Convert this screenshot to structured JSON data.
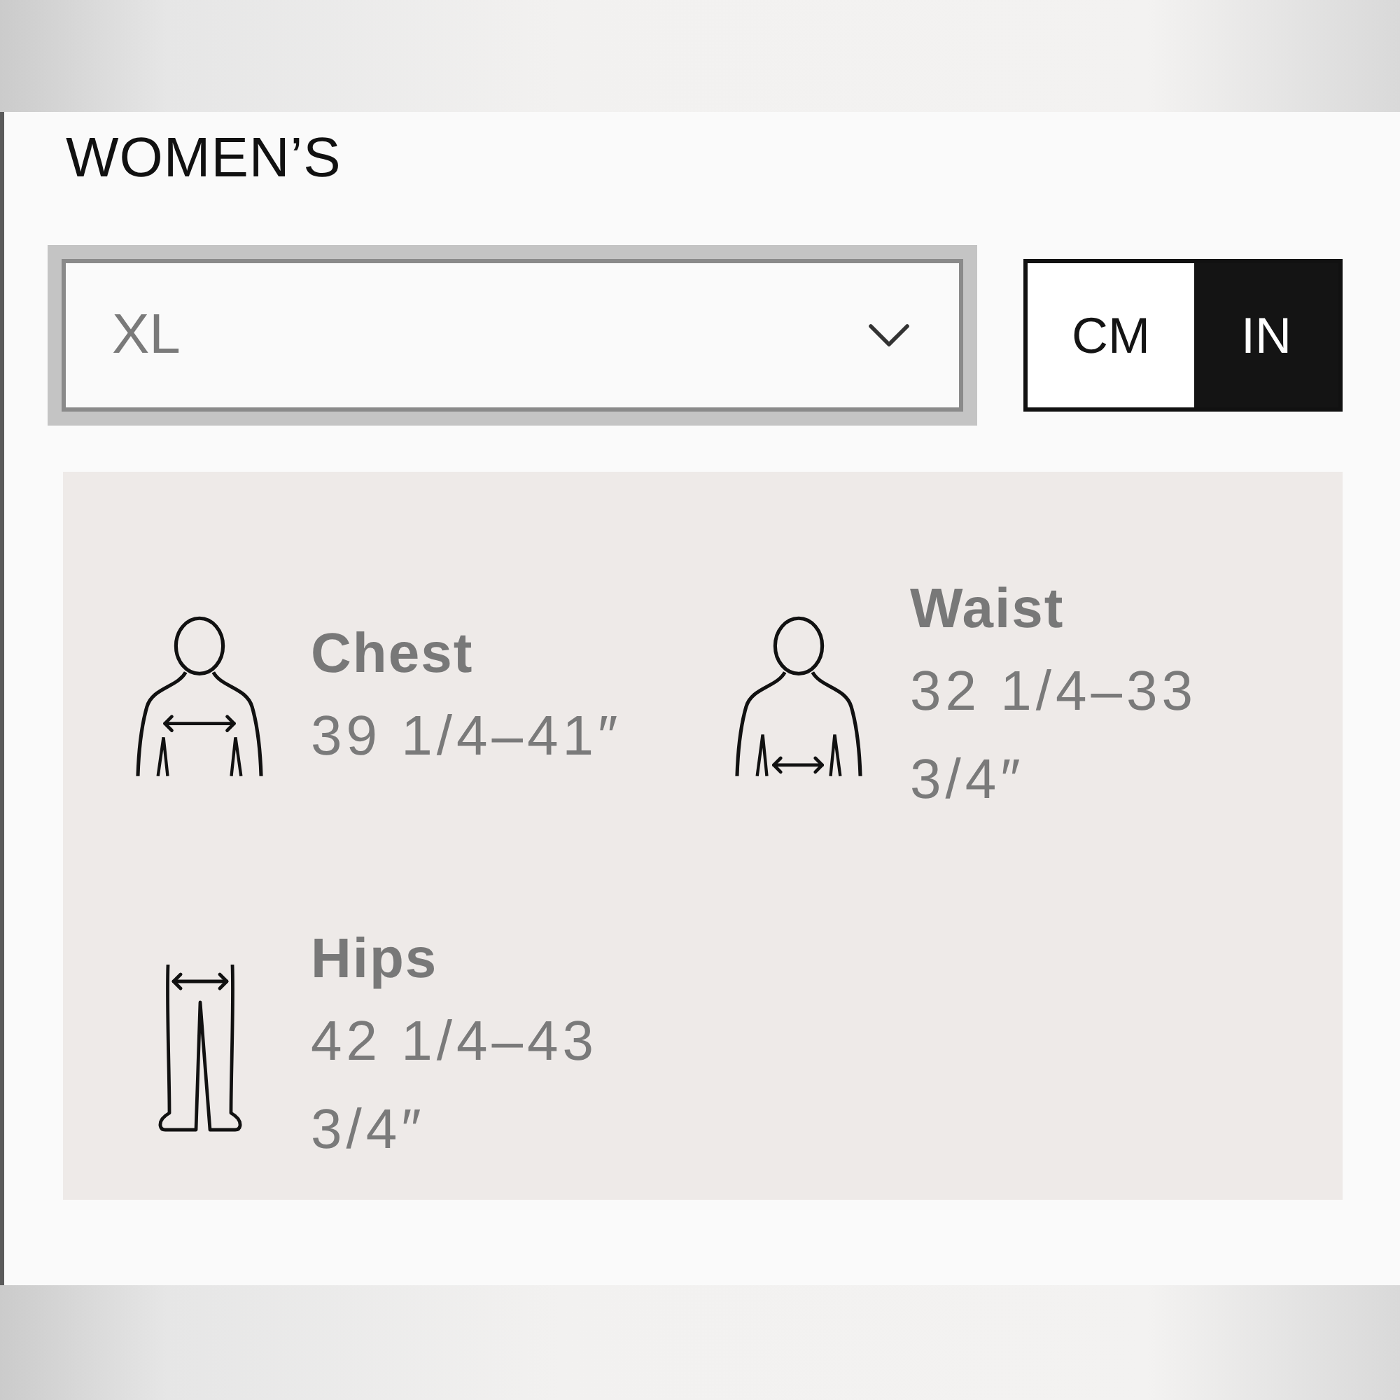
{
  "section": {
    "title": "WOMEN’S"
  },
  "size_select": {
    "value": "XL"
  },
  "units": [
    {
      "label": "CM",
      "selected": false
    },
    {
      "label": "IN",
      "selected": true
    }
  ],
  "measurements": [
    {
      "kind": "chest",
      "label": "Chest",
      "value": "39 1/4–41″"
    },
    {
      "kind": "waist",
      "label": "Waist",
      "value": "32 1/4–33 3/4″"
    },
    {
      "kind": "hips",
      "label": "Hips",
      "value": "42 1/4–43 3/4″"
    }
  ]
}
